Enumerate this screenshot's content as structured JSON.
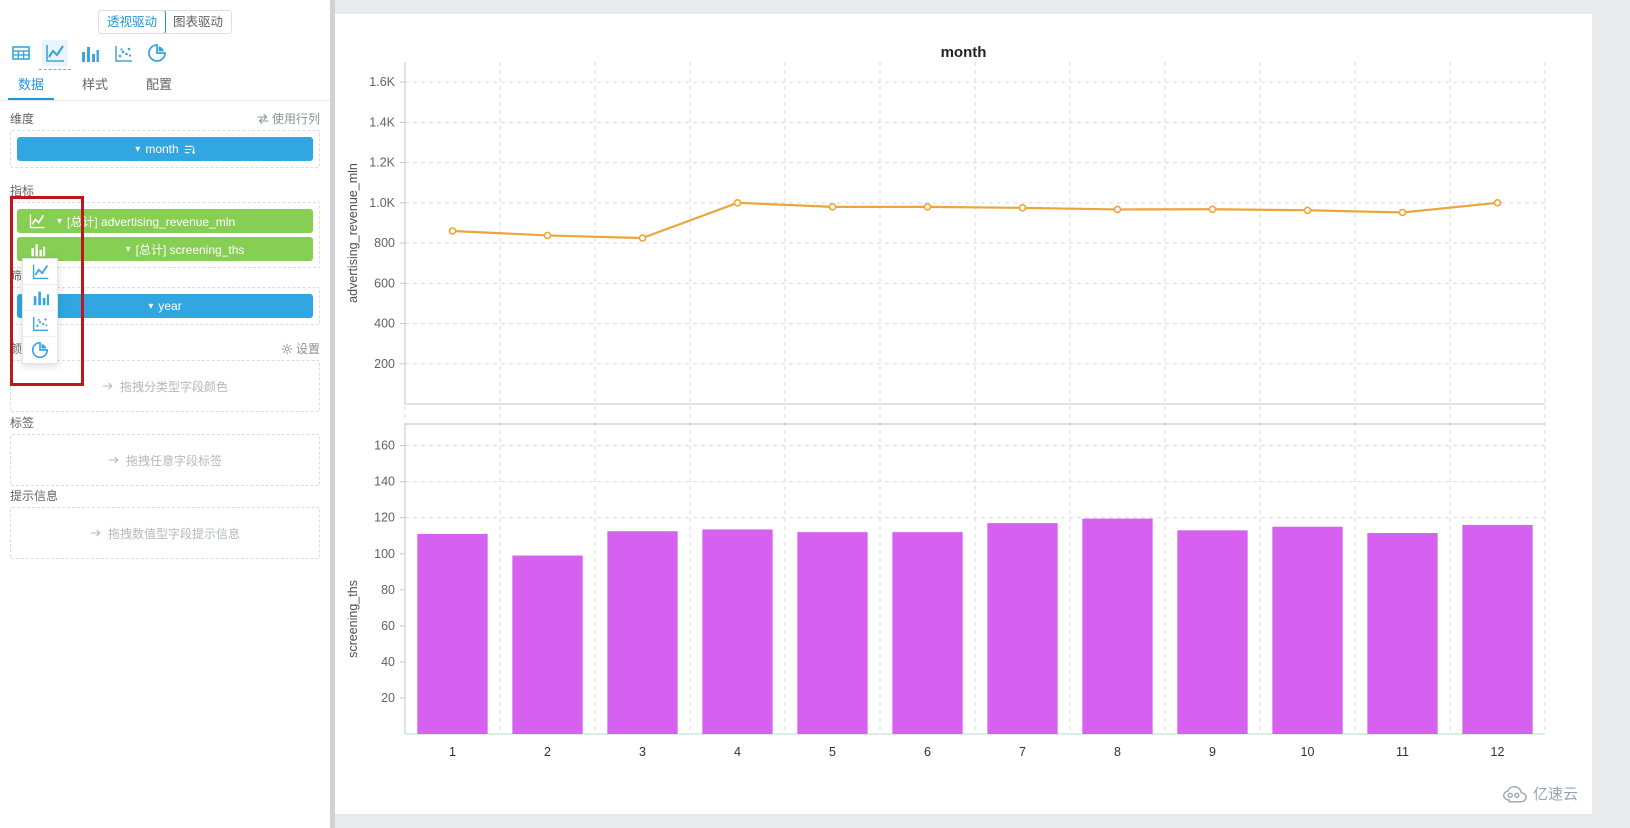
{
  "left_panel": {
    "drive_toggle": {
      "options": [
        {
          "label": "透视驱动",
          "active": true
        },
        {
          "label": "图表驱动",
          "active": false
        }
      ]
    },
    "chart_types": [
      {
        "name": "table-chart-icon",
        "selected": false
      },
      {
        "name": "line-chart-icon",
        "selected": true
      },
      {
        "name": "bar-chart-icon",
        "selected": false
      },
      {
        "name": "scatter-chart-icon",
        "selected": false
      },
      {
        "name": "pie-chart-icon",
        "selected": false
      }
    ],
    "tabs": [
      {
        "label": "数据",
        "active": true
      },
      {
        "label": "样式",
        "active": false
      },
      {
        "label": "配置",
        "active": false
      }
    ],
    "dimension": {
      "title": "维度",
      "action": "使用行列",
      "chips": [
        {
          "label": "month",
          "sort": "排序"
        }
      ]
    },
    "metric": {
      "title": "指标",
      "chips": [
        {
          "label": "[总计] advertising_revenue_mln",
          "icon": "line-chart-icon"
        },
        {
          "label": "[总计] screening_ths",
          "icon": "bar-chart-icon"
        }
      ]
    },
    "filter": {
      "title": "筛选",
      "chips": [
        {
          "label": "year"
        }
      ]
    },
    "color": {
      "title": "颜色",
      "action": "设置",
      "placeholder": "拖拽分类型字段颜色"
    },
    "label": {
      "title": "标签",
      "placeholder": "拖拽任意字段标签"
    },
    "tooltip": {
      "title": "提示信息",
      "placeholder": "拖拽数值型字段提示信息"
    },
    "chart_type_popup": {
      "items": [
        {
          "name": "line-chart-icon"
        },
        {
          "name": "bar-chart-icon"
        },
        {
          "name": "scatter-chart-icon"
        },
        {
          "name": "pie-chart-icon"
        }
      ]
    }
  },
  "watermark": {
    "text": "亿速云"
  },
  "chart_data": [
    {
      "type": "line",
      "title": "month",
      "xlabel": "",
      "ylabel": "advertising_revenue_mln",
      "categories": [
        "1",
        "2",
        "3",
        "4",
        "5",
        "6",
        "7",
        "8",
        "9",
        "10",
        "11",
        "12"
      ],
      "values": [
        860,
        838,
        825,
        1000,
        980,
        980,
        975,
        967,
        968,
        963,
        952,
        1000
      ],
      "ylim": [
        0,
        1700
      ],
      "yticks": [
        200,
        400,
        600,
        800,
        1000,
        1200,
        1400,
        1600
      ],
      "ytick_labels": [
        "200",
        "400",
        "600",
        "800",
        "1.0K",
        "1.2K",
        "1.4K",
        "1.6K"
      ],
      "color": "#eba53c",
      "grid": true,
      "legend": "none"
    },
    {
      "type": "bar",
      "title": "",
      "xlabel": "",
      "ylabel": "screening_ths",
      "categories": [
        "1",
        "2",
        "3",
        "4",
        "5",
        "6",
        "7",
        "8",
        "9",
        "10",
        "11",
        "12"
      ],
      "values": [
        111,
        99,
        112.5,
        113.5,
        112,
        112,
        117,
        119.5,
        113,
        115,
        111.5,
        116
      ],
      "ylim": [
        0,
        172
      ],
      "yticks": [
        20,
        40,
        60,
        80,
        100,
        120,
        140,
        160
      ],
      "ytick_labels": [
        "20",
        "40",
        "60",
        "80",
        "100",
        "120",
        "140",
        "160"
      ],
      "color": "#d濡"
    }
  ]
}
